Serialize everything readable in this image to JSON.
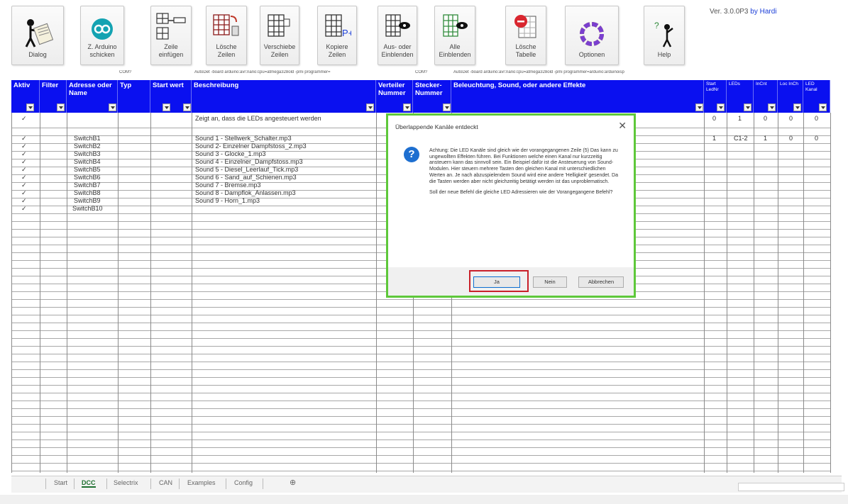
{
  "ribbon": {
    "buttons": [
      {
        "name": "dialog",
        "label": "Dialog",
        "icon": "dialog-figure-icon"
      },
      {
        "name": "send-to-arduino",
        "label": "Z. Arduino\nschicken",
        "icon": "arduino-icon"
      },
      {
        "name": "insert-row",
        "label": "Zeile\neinfügen",
        "icon": "insert-row-icon"
      },
      {
        "name": "delete-rows",
        "label": "Lösche\nZeilen",
        "icon": "delete-rows-icon"
      },
      {
        "name": "move-rows",
        "label": "Verschiebe\nZeilen",
        "icon": "move-rows-icon"
      },
      {
        "name": "copy-rows",
        "label": "Kopiere\nZeilen",
        "icon": "copy-rows-icon"
      },
      {
        "name": "show-hide",
        "label": "Aus- oder\nEinblenden",
        "icon": "eye-icon"
      },
      {
        "name": "show-all",
        "label": "Alle\nEinblenden",
        "icon": "eye-icon"
      },
      {
        "name": "delete-table",
        "label": "Lösche\nTabelle",
        "icon": "delete-table-icon"
      },
      {
        "name": "options",
        "label": "Optionen",
        "icon": "options-ring-icon"
      },
      {
        "name": "help",
        "label": "Help",
        "icon": "help-figure-icon"
      }
    ],
    "version_prefix": "Ver. 3.0.0P3",
    "version_by": "by Hardi"
  },
  "hints": {
    "com1": "COM?",
    "board_text_1": "AutoDet -board arduino:avr:nano:cpu=atmega328old -pmi programmer=",
    "com2": "COM?",
    "board_text_2": "AutoDet -board arduino:avr:nano:cpu=atmega328old -pmi programmer=arduino:arduinoisp"
  },
  "headers": {
    "aktiv": "Aktiv",
    "filter": "Filter",
    "adresse": "Adresse oder Name",
    "typ": "Typ",
    "startwert": "Start wert",
    "beschreibung": "Beschreibung",
    "verteiler": "Verteiler Nummer",
    "stecker": "Stecker-Nummer",
    "effekte": "Beleuchtung, Sound, oder andere Effekte",
    "start_ledn": "Start LedNr",
    "leds": "LEDs",
    "incnt": "InCnt",
    "loc_incb": "Loc InCh",
    "led_kanal": "LED Kanal"
  },
  "rows": [
    {
      "aktiv": "✓",
      "adresse": "",
      "beschreibung": "Zeigt an, dass die LEDs angesteuert werden",
      "start_ledn": "0",
      "leds": "1",
      "incnt": "0",
      "loc": "0",
      "kanal": "0"
    },
    {
      "aktiv": "",
      "adresse": "",
      "beschreibung": "",
      "start_ledn": "",
      "leds": "",
      "incnt": "",
      "loc": "",
      "kanal": ""
    },
    {
      "aktiv": "✓",
      "adresse": "SwitchB1",
      "beschreibung": "Sound 1 - Stellwerk_Schalter.mp3",
      "start_ledn": "1",
      "leds": "C1-2",
      "incnt": "1",
      "loc": "0",
      "kanal": "0"
    },
    {
      "aktiv": "✓",
      "adresse": "SwitchB2",
      "beschreibung": "Sound 2- Einzelner Dampfstoss_2.mp3"
    },
    {
      "aktiv": "✓",
      "adresse": "SwitchB3",
      "beschreibung": "Sound 3 - Glocke_1.mp3"
    },
    {
      "aktiv": "✓",
      "adresse": "SwitchB4",
      "beschreibung": "Sound 4 - Einzelner_Dampfstoss.mp3"
    },
    {
      "aktiv": "✓",
      "adresse": "SwitchB5",
      "beschreibung": "Sound 5 - Diesel_Leerlauf_Tick.mp3"
    },
    {
      "aktiv": "✓",
      "adresse": "SwitchB6",
      "beschreibung": "Sound 6 - Sand_auf_Schienen.mp3"
    },
    {
      "aktiv": "✓",
      "adresse": "SwitchB7",
      "beschreibung": "Sound 7 - Bremse.mp3"
    },
    {
      "aktiv": "✓",
      "adresse": "SwitchB8",
      "beschreibung": "Sound 8 - Dampflok_Anlassen.mp3"
    },
    {
      "aktiv": "✓",
      "adresse": "SwitchB9",
      "beschreibung": "Sound 9 - Horn_1.mp3"
    },
    {
      "aktiv": "✓",
      "adresse": "SwitchB10",
      "beschreibung": ""
    }
  ],
  "dialog": {
    "title": "Überlappende Kanäle entdeckt",
    "close": "✕",
    "icon": "?",
    "para1": "Achtung: Die LED Kanäle sind gleich wie der vorangegangenen Zeile (5) Das kann zu ungewollten Effekten führen. Bei Funktionen welche einen Kanal nur kurzzeitig ansteuern kann das sinnvoll sein. Ein Beispiel dafür ist die Ansteuerung von Sound-Modulen. Hier steuern mehrere Tasten den gleichen Kanal mit unterschiedlichen Werten an. Je nach abzuspielendem Sound wird eine andere 'Helligkeit' gesendet. Da die Tasten werden aber nicht gleichzeitig betätigt werden ist das unproblematisch.",
    "para2": "Soll der neue Befehl die gleiche LED Adressieren wie der Vorangegangene Befehl?",
    "btn_ja": "Ja",
    "btn_nein": "Nein",
    "btn_abbrechen": "Abbrechen"
  },
  "tabs": {
    "start": "Start",
    "dcc": "DCC",
    "selectrix": "Selectrix",
    "can": "CAN",
    "examples": "Examples",
    "config": "Config",
    "add": "⊕"
  },
  "colors": {
    "header_blue": "#0a10f0",
    "dialog_border": "#5ec83a",
    "highlight_red": "#c9202a",
    "active_tab": "#1d6f2f"
  }
}
